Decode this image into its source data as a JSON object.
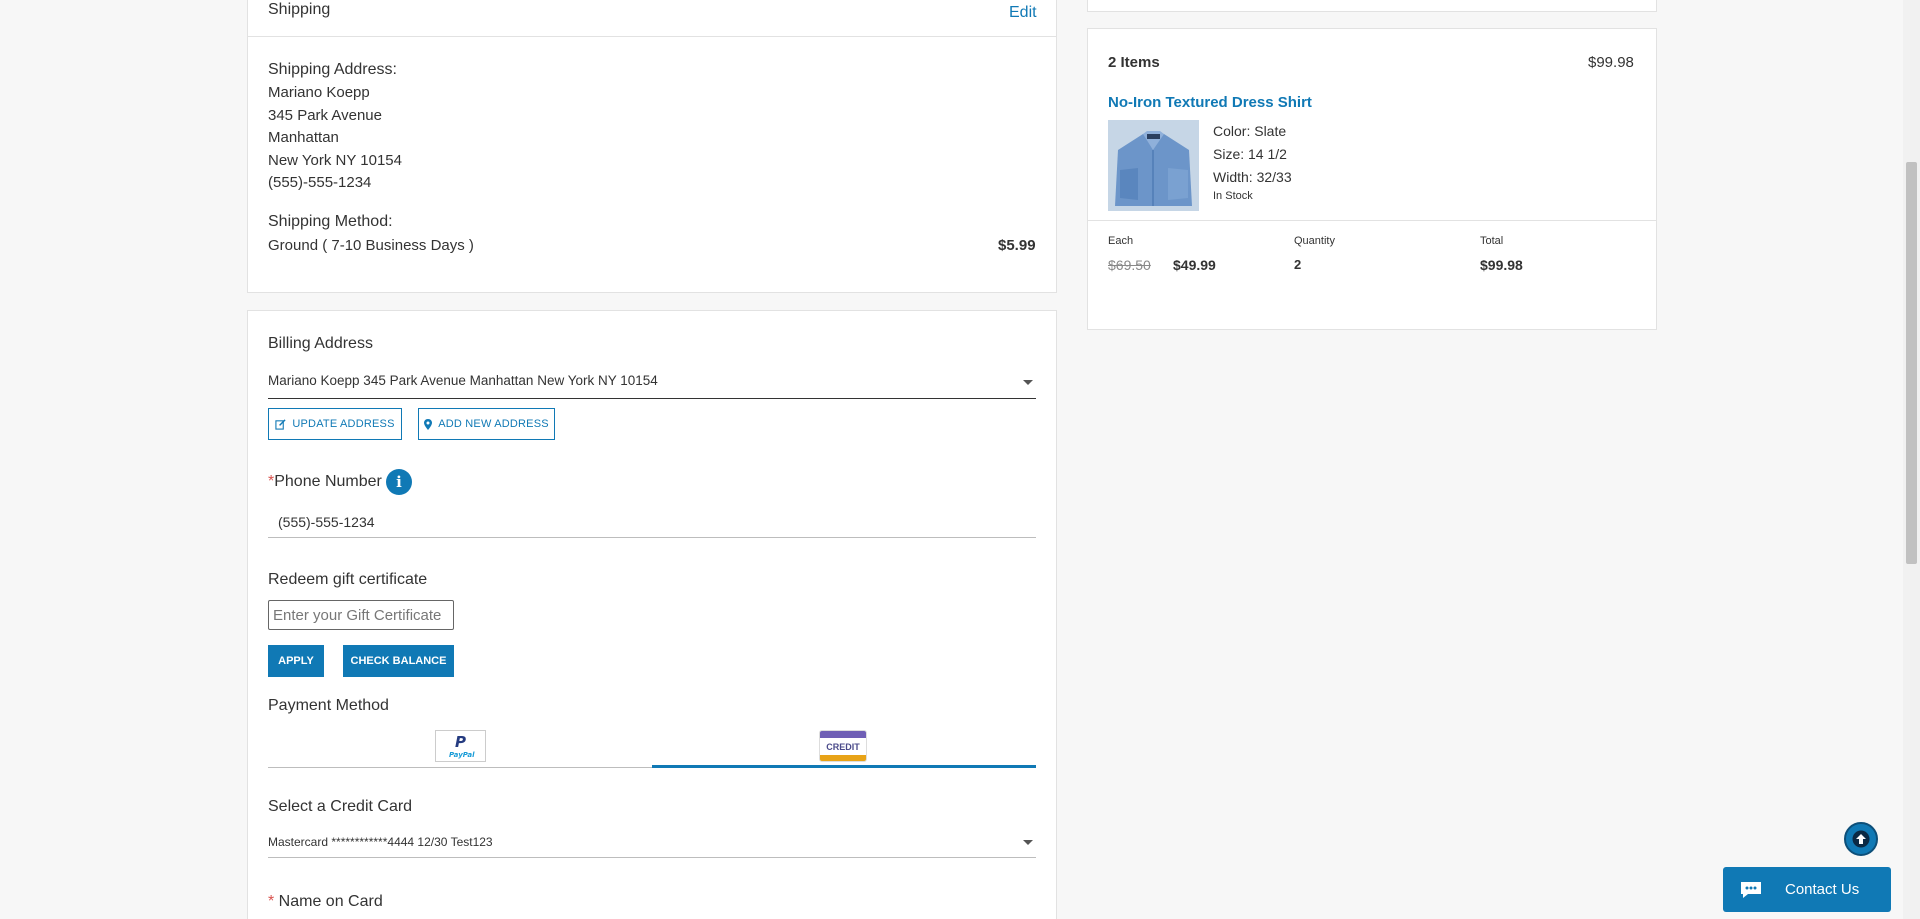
{
  "shipping": {
    "title": "Shipping",
    "edit_label": "Edit",
    "address_label": "Shipping Address:",
    "name": "Mariano Koepp",
    "street": "345 Park Avenue",
    "area": "Manhattan",
    "city_state_zip": "New York NY 10154",
    "phone": "(555)-555-1234",
    "method_label": "Shipping Method:",
    "method_value": "Ground ( 7-10 Business Days )",
    "method_price": "$5.99"
  },
  "billing": {
    "title": "Billing Address",
    "selected_address": "Mariano Koepp 345 Park Avenue Manhattan New York NY 10154",
    "update_label": "UPDATE ADDRESS",
    "add_label": "ADD NEW ADDRESS",
    "phone_required": "*",
    "phone_label": "Phone Number",
    "phone_value": "(555)-555-1234",
    "gift_label": "Redeem gift certificate",
    "gift_placeholder": "Enter your Gift Certificate",
    "apply_label": "APPLY",
    "check_balance_label": "CHECK BALANCE",
    "payment_method_label": "Payment Method",
    "paypal_text": "PayPal",
    "credit_text": "CREDIT",
    "select_card_label": "Select a Credit Card",
    "selected_card": "Mastercard ************4444 12/30 Test123",
    "name_required": "*",
    "name_on_card_label": " Name on Card"
  },
  "summary": {
    "items_count": "2 Items",
    "items_total": "$99.98",
    "product_name": "No-Iron Textured Dress Shirt",
    "color": "Color: Slate",
    "size": "Size: 14 1/2",
    "width": "Width: 32/33",
    "stock": "In Stock",
    "each_label": "Each",
    "orig_price": "$69.50",
    "sale_price": "$49.99",
    "qty_label": "Quantity",
    "qty_value": "2",
    "total_label": "Total",
    "total_value": "$99.98"
  },
  "chat": {
    "label": "Contact Us"
  },
  "colors": {
    "accent": "#1079b5",
    "required": "#d9534f"
  },
  "icons": [
    "edit-icon",
    "map-pin-icon",
    "info-icon",
    "chat-icon",
    "arrow-up-icon",
    "chevron-down-icon"
  ]
}
